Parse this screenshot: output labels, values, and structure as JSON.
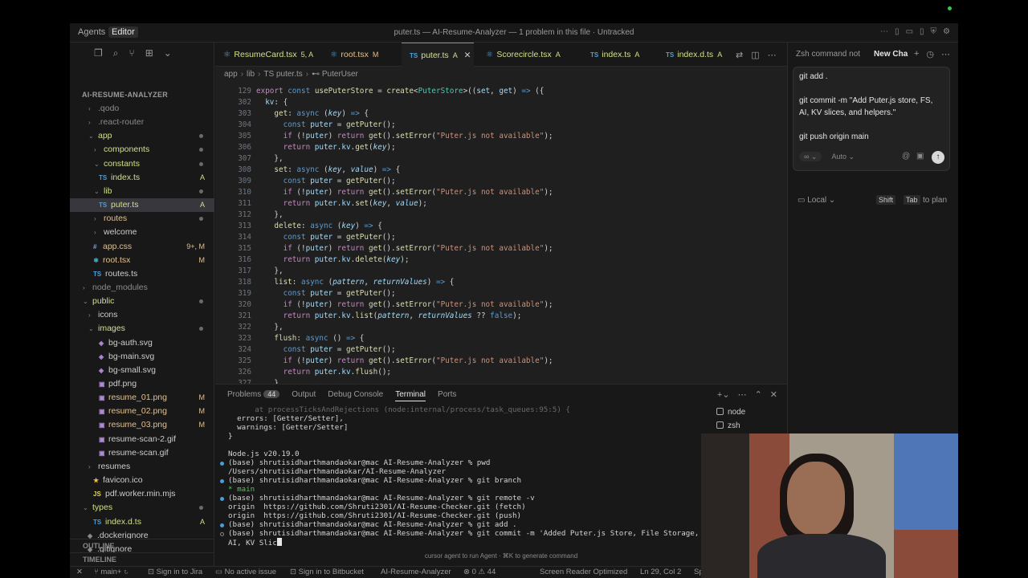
{
  "titlebar": {
    "agents_label": "Agents",
    "editor_label": "Editor",
    "title": "puter.ts — AI-Resume-Analyzer — 1 problem in this file · Untracked"
  },
  "sidebar": {
    "project": "AI-RESUME-ANALYZER",
    "items": [
      {
        "chev": "›",
        "name": ".qodo",
        "color": "c-gray",
        "status": "",
        "dot": false
      },
      {
        "chev": "›",
        "name": ".react-router",
        "color": "c-gray",
        "status": "",
        "dot": false
      },
      {
        "chev": "⌄",
        "name": "app",
        "color": "c-green",
        "status": "",
        "dot": true
      },
      {
        "chev": "›",
        "name": "components",
        "color": "c-green",
        "status": "",
        "dot": true
      },
      {
        "chev": "⌄",
        "name": "constants",
        "color": "c-green",
        "status": "",
        "dot": true
      },
      {
        "icon": "TS",
        "name": "index.ts",
        "color": "c-green",
        "status": "A",
        "dot": false
      },
      {
        "chev": "⌄",
        "name": "lib",
        "color": "c-green",
        "status": "",
        "dot": true
      },
      {
        "icon": "TS",
        "name": "puter.ts",
        "color": "c-green",
        "status": "A",
        "dot": false,
        "selected": true
      },
      {
        "chev": "›",
        "name": "routes",
        "color": "c-yellow",
        "status": "",
        "dot": true
      },
      {
        "chev": "›",
        "name": "welcome",
        "color": "c-norm",
        "status": "",
        "dot": false
      },
      {
        "icon": "#",
        "name": "app.css",
        "color": "c-yellow",
        "status": "9+, M",
        "dot": false
      },
      {
        "icon": "⚛",
        "name": "root.tsx",
        "color": "c-yellow",
        "status": "M",
        "dot": false
      },
      {
        "icon": "TS",
        "name": "routes.ts",
        "color": "c-norm",
        "status": "",
        "dot": false
      },
      {
        "chev": "›",
        "name": "node_modules",
        "color": "c-gray",
        "status": "",
        "dot": false
      },
      {
        "chev": "⌄",
        "name": "public",
        "color": "c-green",
        "status": "",
        "dot": true
      },
      {
        "chev": "›",
        "name": "icons",
        "color": "c-norm",
        "status": "",
        "dot": false
      },
      {
        "chev": "⌄",
        "name": "images",
        "color": "c-green",
        "status": "",
        "dot": true
      },
      {
        "icon": "◈",
        "name": "bg-auth.svg",
        "color": "c-norm",
        "status": "",
        "dot": false
      },
      {
        "icon": "◈",
        "name": "bg-main.svg",
        "color": "c-norm",
        "status": "",
        "dot": false
      },
      {
        "icon": "◈",
        "name": "bg-small.svg",
        "color": "c-norm",
        "status": "",
        "dot": false
      },
      {
        "icon": "▣",
        "name": "pdf.png",
        "color": "c-norm",
        "status": "",
        "dot": false
      },
      {
        "icon": "▣",
        "name": "resume_01.png",
        "color": "c-yellow",
        "status": "M",
        "dot": false
      },
      {
        "icon": "▣",
        "name": "resume_02.png",
        "color": "c-yellow",
        "status": "M",
        "dot": false
      },
      {
        "icon": "▣",
        "name": "resume_03.png",
        "color": "c-yellow",
        "status": "M",
        "dot": false
      },
      {
        "icon": "▣",
        "name": "resume-scan-2.gif",
        "color": "c-norm",
        "status": "",
        "dot": false
      },
      {
        "icon": "▣",
        "name": "resume-scan.gif",
        "color": "c-norm",
        "status": "",
        "dot": false
      },
      {
        "chev": "›",
        "name": "resumes",
        "color": "c-norm",
        "status": "",
        "dot": false
      },
      {
        "icon": "★",
        "name": "favicon.ico",
        "color": "c-norm",
        "status": "",
        "dot": false
      },
      {
        "icon": "JS",
        "name": "pdf.worker.min.mjs",
        "color": "c-norm",
        "status": "",
        "dot": false
      },
      {
        "chev": "⌄",
        "name": "types",
        "color": "c-green",
        "status": "",
        "dot": true
      },
      {
        "icon": "TS",
        "name": "index.d.ts",
        "color": "c-green",
        "status": "A",
        "dot": false
      },
      {
        "icon": "◆",
        "name": ".dockerignore",
        "color": "c-norm",
        "status": "",
        "dot": false
      },
      {
        "icon": "◆",
        "name": ".gitignore",
        "color": "c-norm",
        "status": "",
        "dot": false
      }
    ],
    "outline_label": "OUTLINE",
    "timeline_label": "TIMELINE"
  },
  "tabs": [
    {
      "icon": "⚛",
      "name": "ResumeCard.tsx",
      "status": "5, A",
      "active": false
    },
    {
      "icon": "⚛",
      "name": "root.tsx",
      "status": "M",
      "active": false
    },
    {
      "icon": "TS",
      "name": "puter.ts",
      "status": "A",
      "active": true
    },
    {
      "icon": "⚛",
      "name": "Scorecircle.tsx",
      "status": "A",
      "active": false
    },
    {
      "icon": "TS",
      "name": "index.ts",
      "status": "A",
      "active": false
    },
    {
      "icon": "TS",
      "name": "index.d.ts",
      "status": "A",
      "active": false
    }
  ],
  "breadcrumb": [
    "app",
    "lib",
    "puter.ts",
    "PuterUser"
  ],
  "code": [
    {
      "n": "129",
      "html": "<span class='k'>export</span> <span class='kb'>const</span> <span class='f'>usePuterStore</span> = <span class='f'>create</span>&lt;<span class='t'>PuterStore</span>&gt;((<span class='p'>set</span>, <span class='p'>get</span>) <span class='kb'>=&gt;</span> ({"
    },
    {
      "n": "302",
      "html": "  <span class='p'>kv</span>: {"
    },
    {
      "n": "303",
      "html": "    <span class='f'>get</span>: <span class='kb'>async</span> (<span class='i'>key</span>) <span class='kb'>=&gt;</span> {"
    },
    {
      "n": "304",
      "html": "      <span class='kb'>const</span> <span class='p'>puter</span> = <span class='f'>getPuter</span>();"
    },
    {
      "n": "305",
      "html": "      <span class='k'>if</span> (!<span class='p'>puter</span>) <span class='k'>return</span> <span class='f'>get</span>().<span class='f'>setError</span>(<span class='s'>\"Puter.js not available\"</span>);"
    },
    {
      "n": "306",
      "html": "      <span class='k'>return</span> <span class='p'>puter</span>.<span class='p'>kv</span>.<span class='f'>get</span>(<span class='i'>key</span>);"
    },
    {
      "n": "307",
      "html": "    },"
    },
    {
      "n": "308",
      "html": "    <span class='f'>set</span>: <span class='kb'>async</span> (<span class='i'>key</span>, <span class='i'>value</span>) <span class='kb'>=&gt;</span> {"
    },
    {
      "n": "309",
      "html": "      <span class='kb'>const</span> <span class='p'>puter</span> = <span class='f'>getPuter</span>();"
    },
    {
      "n": "310",
      "html": "      <span class='k'>if</span> (!<span class='p'>puter</span>) <span class='k'>return</span> <span class='f'>get</span>().<span class='f'>setError</span>(<span class='s'>\"Puter.js not available\"</span>);"
    },
    {
      "n": "311",
      "html": "      <span class='k'>return</span> <span class='p'>puter</span>.<span class='p'>kv</span>.<span class='f'>set</span>(<span class='i'>key</span>, <span class='i'>value</span>);"
    },
    {
      "n": "312",
      "html": "    },"
    },
    {
      "n": "313",
      "html": "    <span class='f'>delete</span>: <span class='kb'>async</span> (<span class='i'>key</span>) <span class='kb'>=&gt;</span> {"
    },
    {
      "n": "314",
      "html": "      <span class='kb'>const</span> <span class='p'>puter</span> = <span class='f'>getPuter</span>();"
    },
    {
      "n": "315",
      "html": "      <span class='k'>if</span> (!<span class='p'>puter</span>) <span class='k'>return</span> <span class='f'>get</span>().<span class='f'>setError</span>(<span class='s'>\"Puter.js not available\"</span>);"
    },
    {
      "n": "316",
      "html": "      <span class='k'>return</span> <span class='p'>puter</span>.<span class='p'>kv</span>.<span class='f'>delete</span>(<span class='i'>key</span>);"
    },
    {
      "n": "317",
      "html": "    },"
    },
    {
      "n": "318",
      "html": "    <span class='f'>list</span>: <span class='kb'>async</span> (<span class='i'>pattern</span>, <span class='i'>returnValues</span>) <span class='kb'>=&gt;</span> {"
    },
    {
      "n": "319",
      "html": "      <span class='kb'>const</span> <span class='p'>puter</span> = <span class='f'>getPuter</span>();"
    },
    {
      "n": "320",
      "html": "      <span class='k'>if</span> (!<span class='p'>puter</span>) <span class='k'>return</span> <span class='f'>get</span>().<span class='f'>setError</span>(<span class='s'>\"Puter.js not available\"</span>);"
    },
    {
      "n": "321",
      "html": "      <span class='k'>return</span> <span class='p'>puter</span>.<span class='p'>kv</span>.<span class='f'>list</span>(<span class='i'>pattern</span>, <span class='i'>returnValues</span> ?? <span class='kb'>false</span>);"
    },
    {
      "n": "322",
      "html": "    },"
    },
    {
      "n": "323",
      "html": "    <span class='f'>flush</span>: <span class='kb'>async</span> () <span class='kb'>=&gt;</span> {"
    },
    {
      "n": "324",
      "html": "      <span class='kb'>const</span> <span class='p'>puter</span> = <span class='f'>getPuter</span>();"
    },
    {
      "n": "325",
      "html": "      <span class='k'>if</span> (!<span class='p'>puter</span>) <span class='k'>return</span> <span class='f'>get</span>().<span class='f'>setError</span>(<span class='s'>\"Puter.js not available\"</span>);"
    },
    {
      "n": "326",
      "html": "      <span class='k'>return</span> <span class='p'>puter</span>.<span class='p'>kv</span>.<span class='f'>flush</span>();"
    },
    {
      "n": "327",
      "html": "    },"
    }
  ],
  "panel": {
    "tabs": [
      "Problems",
      "Output",
      "Debug Console",
      "Terminal",
      "Ports"
    ],
    "problems_count": "44",
    "active_tab": "Terminal",
    "terminal_lines": [
      {
        "text": "      at processTicksAndRejections (node:internal/process/task_queues:95:5) {",
        "dot": "",
        "dim": true
      },
      {
        "text": "  errors: [Getter/Setter],",
        "dot": ""
      },
      {
        "text": "  warnings: [Getter/Setter]",
        "dot": ""
      },
      {
        "text": "}",
        "dot": ""
      },
      {
        "text": "",
        "dot": ""
      },
      {
        "text": "Node.js v20.19.0",
        "dot": ""
      },
      {
        "text": "(base) shrutisidharthmandaokar@mac AI-Resume-Analyzer % pwd",
        "dot": "b"
      },
      {
        "text": "/Users/shrutisidharthmandaokar/AI-Resume-Analyzer",
        "dot": ""
      },
      {
        "text": "(base) shrutisidharthmandaokar@mac AI-Resume-Analyzer % git branch",
        "dot": "b"
      },
      {
        "text": "* main",
        "dot": "",
        "green": true
      },
      {
        "text": "(base) shrutisidharthmandaokar@mac AI-Resume-Analyzer % git remote -v",
        "dot": "b"
      },
      {
        "text": "origin  https://github.com/Shruti2301/AI-Resume-Checker.git (fetch)",
        "dot": ""
      },
      {
        "text": "origin  https://github.com/Shruti2301/AI-Resume-Checker.git (push)",
        "dot": ""
      },
      {
        "text": "(base) shrutisidharthmandaokar@mac AI-Resume-Analyzer % git add .",
        "dot": "b"
      },
      {
        "text": "(base) shrutisidharthmandaokar@mac AI-Resume-Analyzer % git commit -m 'Added Puter.js Store, File Storage,",
        "dot": "h"
      },
      {
        "text": "AI, KV Slic",
        "dot": "",
        "cursor": true
      }
    ],
    "terminals": [
      "node",
      "zsh"
    ],
    "hint": "cursor agent to run Agent · ⌘K to generate command"
  },
  "chat": {
    "tab_prev": "Zsh command not",
    "tab_active": "New Cha",
    "message_lines": [
      "git add .",
      "",
      "git commit -m \"Add Puter.js store, FS,",
      "AI, KV slices, and helpers.\"",
      "",
      "git push origin main"
    ],
    "mode": "∞ ⌄",
    "model": "Auto ⌄",
    "local": "Local ⌄",
    "kbd_shift": "Shift",
    "kbd_tab": "Tab",
    "plan_text": "to plan"
  },
  "statusbar": {
    "branch": "main+",
    "jira": "Sign in to Jira",
    "issue": "No active issue",
    "bitbucket": "Sign in to Bitbucket",
    "project": "AI-Resume-Analyzer",
    "problems": "⊗ 0 ⚠ 44",
    "reader": "Screen Reader Optimized",
    "position": "Ln 29, Col 2",
    "spaces": "Sp"
  }
}
